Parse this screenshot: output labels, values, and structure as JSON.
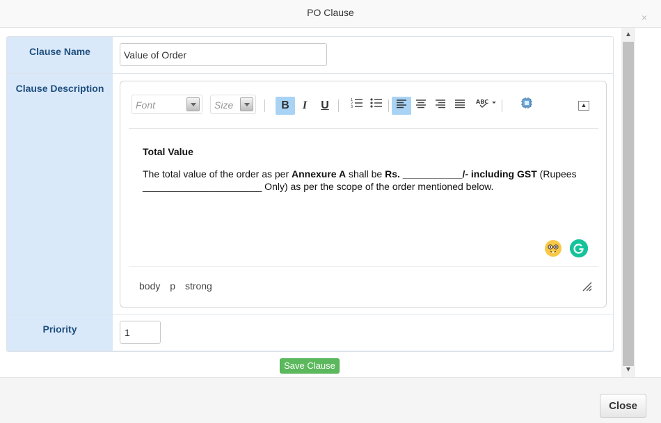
{
  "modal": {
    "title": "PO Clause",
    "close_x": "×",
    "close_button": "Close"
  },
  "form": {
    "clause_name_label": "Clause Name",
    "clause_name_value": "Value of Order",
    "clause_description_label": "Clause Description",
    "priority_label": "Priority",
    "priority_value": "1",
    "save_button": "Save Clause"
  },
  "editor": {
    "font_placeholder": "Font",
    "size_placeholder": "Size",
    "toolbar": {
      "bold": "B",
      "italic": "I",
      "underline": "U",
      "active": [
        "bold",
        "align-left"
      ]
    },
    "content": {
      "heading": "Total Value",
      "p1_a": "The total value of the order as per ",
      "p1_b": "Annexure A",
      "p1_c": " shall be ",
      "p1_d": "Rs. ___________/- including GST",
      "p1_e": " (Rupees ______________________ Only) as per the scope of the order mentioned below."
    },
    "path": [
      "body",
      "p",
      "strong"
    ]
  },
  "colors": {
    "label_bg": "#d9e9f9",
    "label_text": "#1f4f7f",
    "save_green": "#5cb85c",
    "active_btn": "#a9d3f5"
  }
}
